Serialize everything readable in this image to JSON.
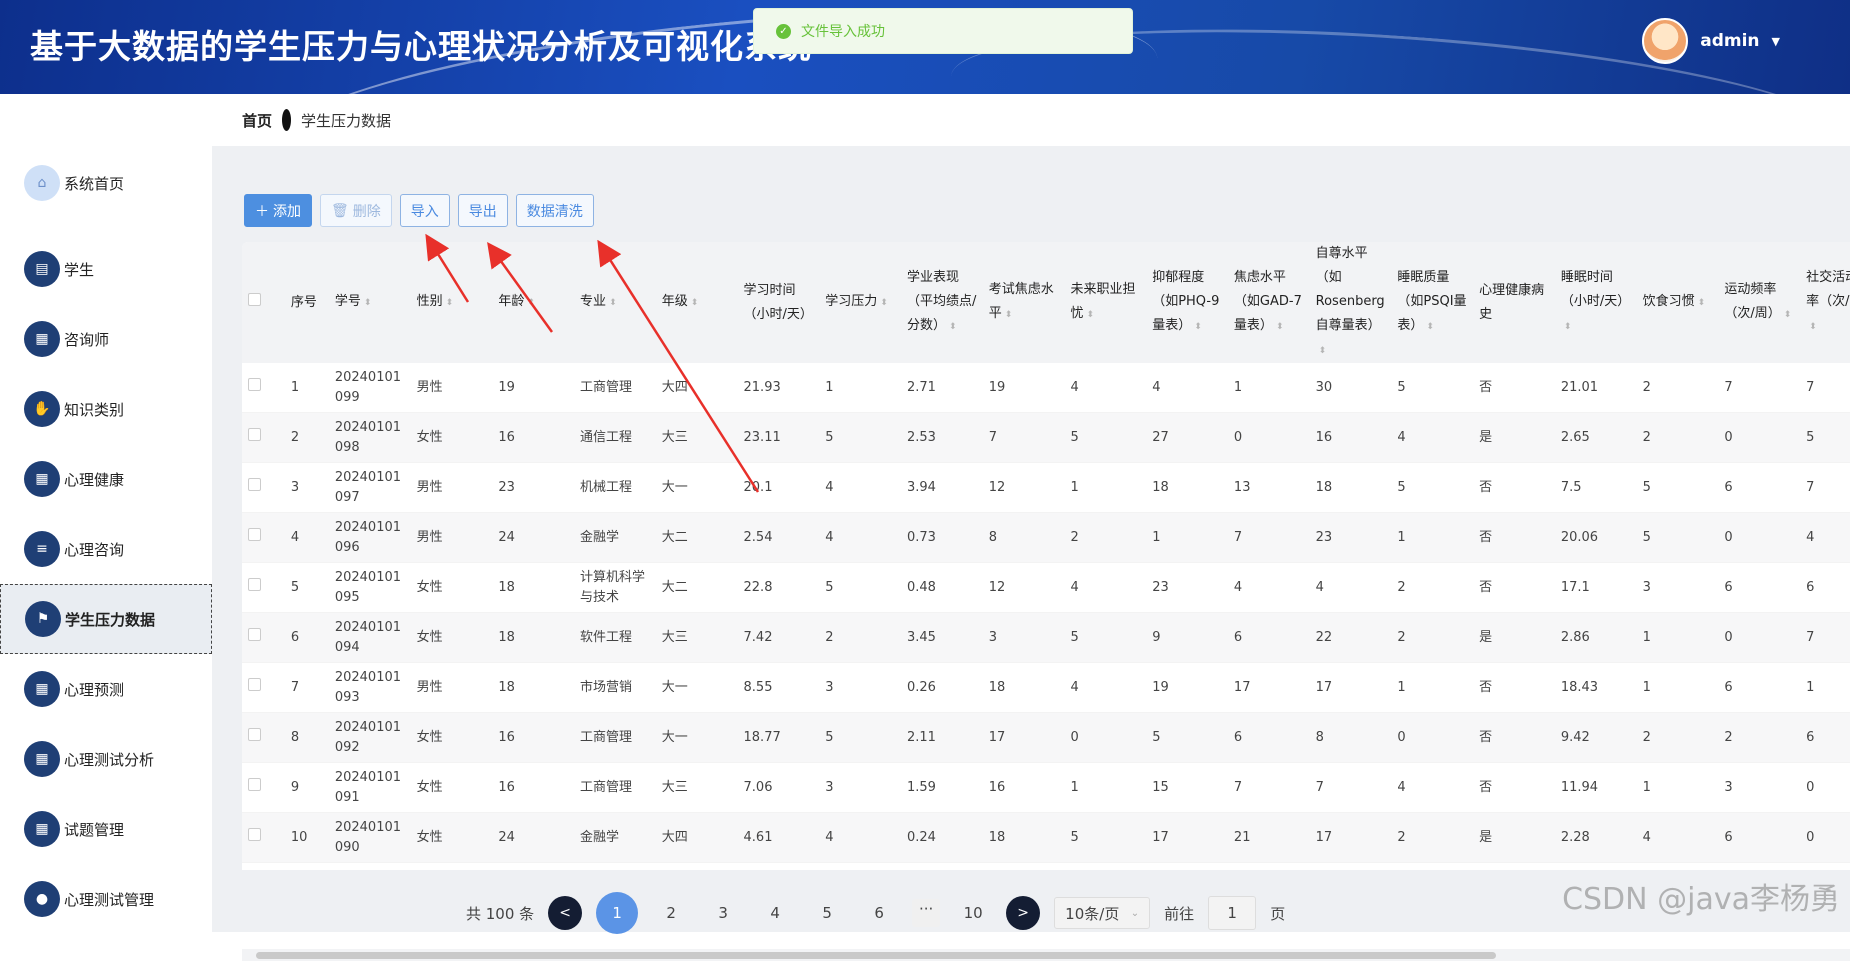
{
  "header": {
    "title": "基于大数据的学生压力与心理状况分析及可视化系统",
    "user": "admin",
    "user_caret": "▼"
  },
  "toast": {
    "message": "文件导入成功"
  },
  "sidebar": {
    "items": [
      {
        "label": "系统首页",
        "icon": "home-icon",
        "glyph": "⌂"
      },
      {
        "label": "学生",
        "icon": "chat-icon",
        "glyph": "▤"
      },
      {
        "label": "咨询师",
        "icon": "grid-icon",
        "glyph": "▦"
      },
      {
        "label": "知识类别",
        "icon": "thumb-icon",
        "glyph": "✋"
      },
      {
        "label": "心理健康",
        "icon": "grid-icon",
        "glyph": "▦"
      },
      {
        "label": "心理咨询",
        "icon": "list-icon",
        "glyph": "≡"
      },
      {
        "label": "学生压力数据",
        "icon": "flag-icon",
        "glyph": "⚑"
      },
      {
        "label": "心理预测",
        "icon": "grid-icon",
        "glyph": "▦"
      },
      {
        "label": "心理测试分析",
        "icon": "grid-icon",
        "glyph": "▦"
      },
      {
        "label": "试题管理",
        "icon": "grid-icon",
        "glyph": "▦"
      },
      {
        "label": "心理测试管理",
        "icon": "bulb-icon",
        "glyph": "●"
      }
    ]
  },
  "breadcrumb": {
    "home": "首页",
    "current": "学生压力数据"
  },
  "toolbar": {
    "add": "添加",
    "delete": "删除",
    "import": "导入",
    "export": "导出",
    "clean": "数据清洗"
  },
  "table": {
    "headers": [
      "序号",
      "学号",
      "性别",
      "年龄",
      "专业",
      "年级",
      "学习时间（小时/天）",
      "学习压力",
      "学业表现（平均绩点/分数）",
      "考试焦虑水平",
      "未来职业担忧",
      "抑郁程度（如PHQ-9量表）",
      "焦虑水平（如GAD-7量表）",
      "自尊水平（如Rosenberg自尊量表）",
      "睡眠质量（如PSQI量表）",
      "心理健康病史",
      "睡眠时间（小时/天）",
      "饮食习惯",
      "运动频率（次/周）",
      "社交活动频率（次/周）"
    ],
    "rows": [
      [
        "1",
        "20240101099",
        "男性",
        "19",
        "工商管理",
        "大四",
        "21.93",
        "1",
        "2.71",
        "19",
        "4",
        "4",
        "1",
        "30",
        "5",
        "否",
        "21.01",
        "2",
        "7",
        "7"
      ],
      [
        "2",
        "20240101098",
        "女性",
        "16",
        "通信工程",
        "大三",
        "23.11",
        "5",
        "2.53",
        "7",
        "5",
        "27",
        "0",
        "16",
        "4",
        "是",
        "2.65",
        "2",
        "0",
        "5"
      ],
      [
        "3",
        "20240101097",
        "男性",
        "23",
        "机械工程",
        "大一",
        "20.1",
        "4",
        "3.94",
        "12",
        "1",
        "18",
        "13",
        "18",
        "5",
        "否",
        "7.5",
        "5",
        "6",
        "7"
      ],
      [
        "4",
        "20240101096",
        "男性",
        "24",
        "金融学",
        "大二",
        "2.54",
        "4",
        "0.73",
        "8",
        "2",
        "1",
        "7",
        "23",
        "1",
        "否",
        "20.06",
        "5",
        "0",
        "4"
      ],
      [
        "5",
        "20240101095",
        "女性",
        "18",
        "计算机科学与技术",
        "大二",
        "22.8",
        "5",
        "0.48",
        "12",
        "4",
        "23",
        "4",
        "4",
        "2",
        "否",
        "17.1",
        "3",
        "6",
        "6"
      ],
      [
        "6",
        "20240101094",
        "女性",
        "18",
        "软件工程",
        "大三",
        "7.42",
        "2",
        "3.45",
        "3",
        "5",
        "9",
        "6",
        "22",
        "2",
        "是",
        "2.86",
        "1",
        "0",
        "7"
      ],
      [
        "7",
        "20240101093",
        "男性",
        "18",
        "市场营销",
        "大一",
        "8.55",
        "3",
        "0.26",
        "18",
        "4",
        "19",
        "17",
        "17",
        "1",
        "否",
        "18.43",
        "1",
        "6",
        "1"
      ],
      [
        "8",
        "20240101092",
        "女性",
        "16",
        "工商管理",
        "大一",
        "18.77",
        "5",
        "2.11",
        "17",
        "0",
        "5",
        "6",
        "8",
        "0",
        "否",
        "9.42",
        "2",
        "2",
        "6"
      ],
      [
        "9",
        "20240101091",
        "女性",
        "16",
        "工商管理",
        "大三",
        "7.06",
        "3",
        "1.59",
        "16",
        "1",
        "15",
        "7",
        "7",
        "4",
        "否",
        "11.94",
        "1",
        "3",
        "0"
      ],
      [
        "10",
        "20240101090",
        "女性",
        "24",
        "金融学",
        "大四",
        "4.61",
        "4",
        "0.24",
        "18",
        "5",
        "17",
        "21",
        "17",
        "2",
        "是",
        "2.28",
        "4",
        "6",
        "0"
      ]
    ]
  },
  "pagination": {
    "total": "共 100 条",
    "prev": "<",
    "next": ">",
    "pages": [
      "1",
      "2",
      "3",
      "4",
      "5",
      "6"
    ],
    "ellipsis": "···",
    "last": "10",
    "page_size": "10条/页",
    "goto_prefix": "前往",
    "goto_value": "1",
    "goto_suffix": "页"
  },
  "watermark": "CSDN @java李杨勇"
}
